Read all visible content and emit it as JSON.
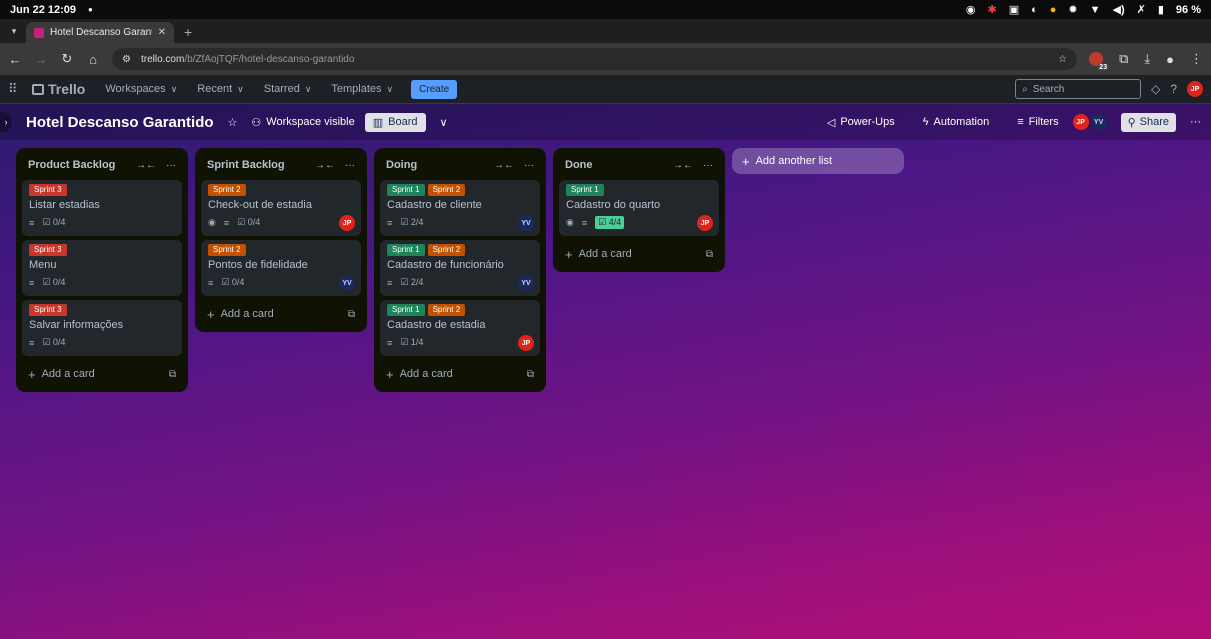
{
  "os": {
    "date_time": "Jun 22  12:09",
    "battery": "96 %"
  },
  "browser": {
    "tab_title": "Hotel Descanso Garantido |",
    "url_host": "trello.com",
    "url_path": "/b/ZfAojTQF/hotel-descanso-garantido",
    "ext_badge": "23"
  },
  "header": {
    "logo": "Trello",
    "menus": [
      "Workspaces",
      "Recent",
      "Starred",
      "Templates"
    ],
    "create": "Create",
    "search_placeholder": "Search",
    "user_initials": "JP"
  },
  "board": {
    "title": "Hotel Descanso Garantido",
    "visibility": "Workspace visible",
    "view": "Board",
    "power_ups": "Power-Ups",
    "automation": "Automation",
    "filters": "Filters",
    "share": "Share",
    "members": [
      "JP",
      "YV"
    ],
    "add_list": "Add another list",
    "add_card": "Add a card",
    "lists": [
      {
        "name": "Product Backlog",
        "cards": [
          {
            "labels": [
              {
                "text": "Sprint 3",
                "color": "red"
              }
            ],
            "title": "Listar estadias",
            "watch": false,
            "desc": true,
            "checklist": "0/4",
            "complete": false,
            "member": ""
          },
          {
            "labels": [
              {
                "text": "Sprint 3",
                "color": "red"
              }
            ],
            "title": "Menu",
            "watch": false,
            "desc": true,
            "checklist": "0/4",
            "complete": false,
            "member": ""
          },
          {
            "labels": [
              {
                "text": "Sprint 3",
                "color": "red"
              }
            ],
            "title": "Salvar informações",
            "watch": false,
            "desc": true,
            "checklist": "0/4",
            "complete": false,
            "member": ""
          }
        ]
      },
      {
        "name": "Sprint Backlog",
        "cards": [
          {
            "labels": [
              {
                "text": "Sprint 2",
                "color": "orange"
              }
            ],
            "title": "Check-out de estadia",
            "watch": true,
            "desc": true,
            "checklist": "0/4",
            "complete": false,
            "member": "JP"
          },
          {
            "labels": [
              {
                "text": "Sprint 2",
                "color": "orange"
              }
            ],
            "title": "Pontos de fidelidade",
            "watch": false,
            "desc": true,
            "checklist": "0/4",
            "complete": false,
            "member": "YV"
          }
        ]
      },
      {
        "name": "Doing",
        "cards": [
          {
            "labels": [
              {
                "text": "Sprint 1",
                "color": "green"
              },
              {
                "text": "Sprint 2",
                "color": "orange"
              }
            ],
            "title": "Cadastro de cliente",
            "watch": false,
            "desc": true,
            "checklist": "2/4",
            "complete": false,
            "member": "YV"
          },
          {
            "labels": [
              {
                "text": "Sprint 1",
                "color": "green"
              },
              {
                "text": "Sprint 2",
                "color": "orange"
              }
            ],
            "title": "Cadastro de funcionário",
            "watch": false,
            "desc": true,
            "checklist": "2/4",
            "complete": false,
            "member": "YV"
          },
          {
            "labels": [
              {
                "text": "Sprint 1",
                "color": "green"
              },
              {
                "text": "Sprint 2",
                "color": "orange"
              }
            ],
            "title": "Cadastro de estadia",
            "watch": false,
            "desc": true,
            "checklist": "1/4",
            "complete": false,
            "member": "JP"
          }
        ]
      },
      {
        "name": "Done",
        "cards": [
          {
            "labels": [
              {
                "text": "Sprint 1",
                "color": "green"
              }
            ],
            "title": "Cadastro do quarto",
            "watch": true,
            "desc": true,
            "checklist": "4/4",
            "complete": true,
            "member": "JP"
          }
        ]
      }
    ]
  }
}
